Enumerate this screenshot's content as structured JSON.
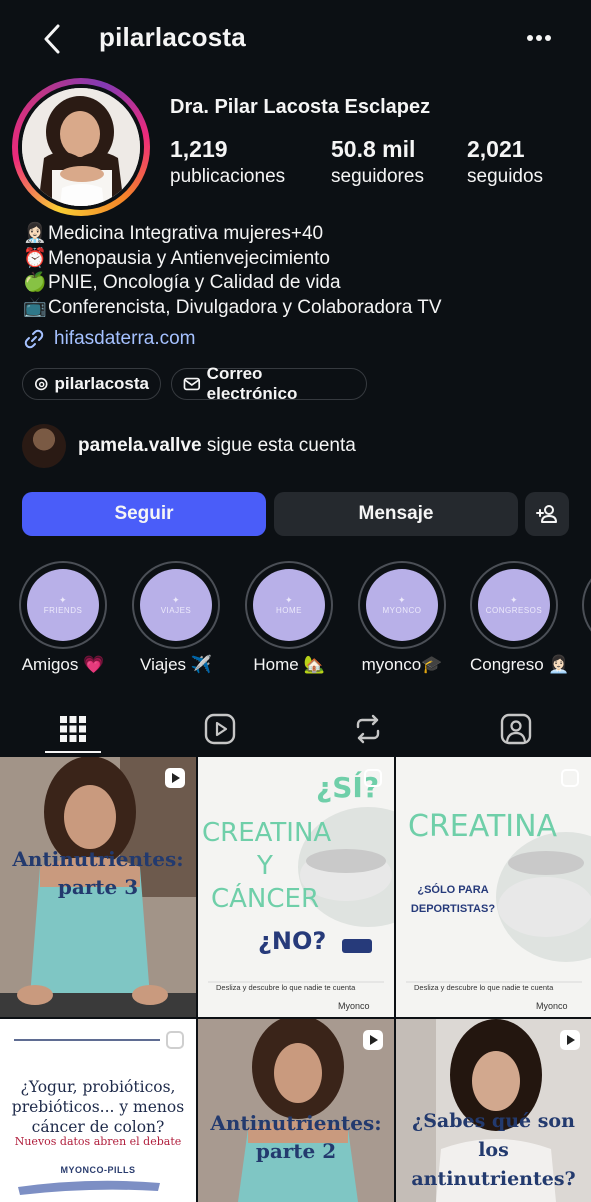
{
  "header": {
    "username": "pilarlacosta"
  },
  "profile": {
    "full_name": "Dra. Pilar Lacosta Esclapez",
    "stats": [
      {
        "value": "1,219",
        "label": "publicaciones"
      },
      {
        "value": "50.8 mil",
        "label": "seguidores"
      },
      {
        "value": "2,021",
        "label": "seguidos"
      }
    ],
    "bio": [
      {
        "emoji": "👩🏻‍⚕️",
        "text": "Medicina Integrativa mujeres+40"
      },
      {
        "emoji": "⏰",
        "text": "Menopausia y Antienvejecimiento"
      },
      {
        "emoji": "🍏",
        "text": "PNIE, Oncología y Calidad de vida"
      },
      {
        "emoji": "📺",
        "text": "Conferencista, Divulgadora y Colaboradora TV"
      }
    ],
    "link": "hifasdaterra.com",
    "chips": {
      "threads": "pilarlacosta",
      "email": "Correo electrónico"
    },
    "followed_by": {
      "user": "pamela.vallve",
      "text": " sigue esta cuenta"
    }
  },
  "actions": {
    "follow": "Seguir",
    "message": "Mensaje"
  },
  "highlights": [
    {
      "cover": "FRIENDS",
      "label": "Amigos 💗"
    },
    {
      "cover": "VIAJES",
      "label": "Viajes ✈️"
    },
    {
      "cover": "HOME",
      "label": "Home 🏡"
    },
    {
      "cover": "MYONCO",
      "label": "myonco🎓"
    },
    {
      "cover": "CONGRESOS",
      "label": "Congreso 👩🏻‍💼"
    }
  ],
  "posts": {
    "p1": "Antinutrientes: parte 3",
    "p2_top": "¿SÍ?",
    "p2_main": "CREATINA Y CÁNCER",
    "p2_bottom": "¿NO?",
    "p2_footer": "Desliza y descubre lo que  nadie te cuenta",
    "p2_brand": "Myonco",
    "p3_main": "CREATINA",
    "p3_sub": "¿SÓLO PARA DEPORTISTAS?",
    "p3_footer": "Desliza y descubre lo que  nadie te cuenta",
    "p3_brand": "Myonco",
    "p4_main": "¿Yogur, probióticos, prebióticos... y menos cáncer de colon?",
    "p4_sub": "Nuevos datos abren el debate",
    "p4_brand": "MYONCO-PILLS",
    "p5": "Antinutrientes: parte 2",
    "p6": "¿Sabes qué son los antinutrientes?"
  },
  "colors": {
    "background": "#0c1014",
    "accent": "#4a5df9",
    "link": "#a5c1ff",
    "secondary_button": "#25292e",
    "highlight_cover": "#b8b0e8",
    "creatina_green": "#6fcfa9"
  }
}
